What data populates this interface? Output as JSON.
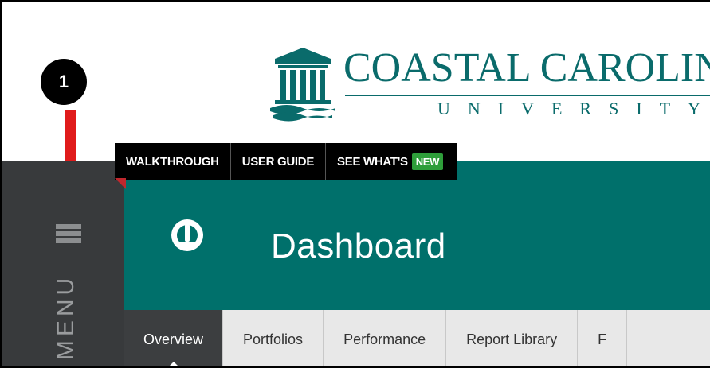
{
  "logo": {
    "name": "COASTAL CAROLINA",
    "sub": "UNIVERSITY"
  },
  "callout": {
    "number": "1"
  },
  "topbar": {
    "walkthrough": "WALKTHROUGH",
    "user_guide": "USER GUIDE",
    "see_whats": "SEE WHAT'S",
    "new_badge": "NEW"
  },
  "sidebar": {
    "menu_label": "MENU",
    "hamburger_icon": "hamburger-icon"
  },
  "header": {
    "title": "Dashboard",
    "icon": "gauge-icon"
  },
  "tabs": [
    {
      "label": "Overview"
    },
    {
      "label": "Portfolios"
    },
    {
      "label": "Performance"
    },
    {
      "label": "Report Library"
    },
    {
      "label": "F"
    }
  ],
  "colors": {
    "teal": "#00706b",
    "rail": "#383a3c",
    "new_badge": "#2e9e3a",
    "arrow": "#e01b1b"
  }
}
